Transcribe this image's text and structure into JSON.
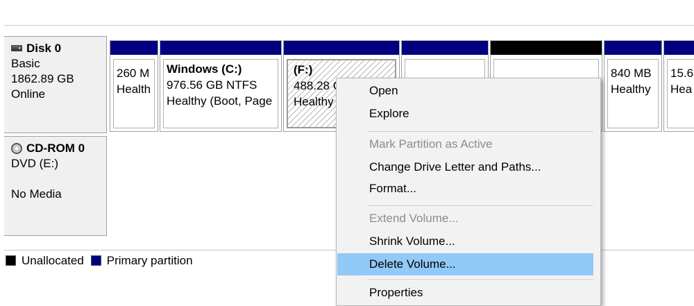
{
  "disks": [
    {
      "name": "Disk 0",
      "type": "Basic",
      "size": "1862.89 GB",
      "status": "Online"
    },
    {
      "name": "CD-ROM 0",
      "type": "DVD (E:)",
      "status": "No Media"
    }
  ],
  "partitions": [
    {
      "name": "",
      "line1": "260 M",
      "line2": "Health",
      "style": "primary"
    },
    {
      "name": "Windows  (C:)",
      "line1": "976.56 GB NTFS",
      "line2": "Healthy (Boot, Page",
      "style": "primary"
    },
    {
      "name": "(F:)",
      "line1": "488.28 G",
      "line2": "Healthy",
      "style": "primary-selected"
    },
    {
      "name": "",
      "line1": "",
      "line2": "",
      "style": "primary"
    },
    {
      "name": "",
      "line1": "",
      "line2": "",
      "style": "unallocated"
    },
    {
      "name": "",
      "line1": "840 MB",
      "line2": "Healthy",
      "style": "primary"
    },
    {
      "name": "",
      "line1": "15.6",
      "line2": "Hea",
      "style": "primary"
    }
  ],
  "legend": [
    {
      "label": "Unallocated",
      "color": "#000000"
    },
    {
      "label": "Primary partition",
      "color": "#000080"
    }
  ],
  "context_menu": {
    "items": [
      {
        "label": "Open",
        "disabled": false
      },
      {
        "label": "Explore",
        "disabled": false
      },
      {
        "label": "Mark Partition as Active",
        "disabled": true
      },
      {
        "label": "Change Drive Letter and Paths...",
        "disabled": false
      },
      {
        "label": "Format...",
        "disabled": false
      },
      {
        "label": "Extend Volume...",
        "disabled": true
      },
      {
        "label": "Shrink Volume...",
        "disabled": false
      },
      {
        "label": "Delete Volume...",
        "disabled": false,
        "highlighted": true
      },
      {
        "label": "Properties",
        "disabled": false
      }
    ]
  },
  "colors": {
    "primary_partition": "#000080",
    "unallocated": "#000000",
    "menu_highlight": "#91c9f7",
    "menu_background": "#f2f2f2"
  }
}
